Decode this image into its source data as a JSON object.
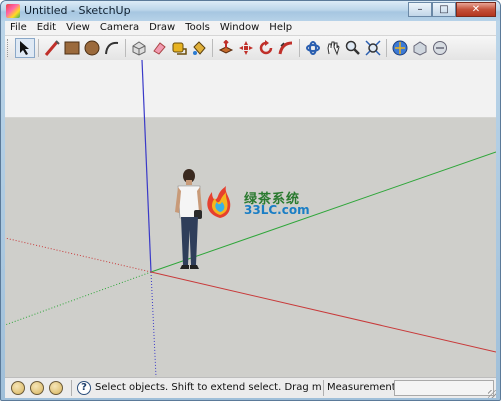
{
  "window": {
    "title": "Untitled - SketchUp",
    "controls": {
      "minimize": "–",
      "maximize": "□",
      "close": "✕"
    }
  },
  "menu": {
    "items": [
      "File",
      "Edit",
      "View",
      "Camera",
      "Draw",
      "Tools",
      "Window",
      "Help"
    ]
  },
  "toolbar": {
    "tools": [
      "select-icon",
      "line-icon",
      "rectangle-icon",
      "circle-icon",
      "arc-icon",
      "make-component-icon",
      "eraser-icon",
      "tape-measure-icon",
      "paint-bucket-icon",
      "push-pull-icon",
      "move-icon",
      "rotate-icon",
      "follow-me-icon",
      "orbit-icon",
      "pan-icon",
      "zoom-icon",
      "zoom-extents-icon",
      "get-models-icon",
      "share-model-icon",
      "share-component-icon"
    ],
    "active_tool": "select-icon"
  },
  "viewport": {
    "axis_colors": {
      "red": "#c83a3a",
      "green": "#2fa63a",
      "blue": "#3a3ac8"
    },
    "watermark": {
      "line1": "绿茶系统",
      "line2": "33LC.com"
    }
  },
  "statusbar": {
    "hint": "Select objects. Shift to extend select. Drag mo",
    "measurements_label": "Measurements",
    "measurements_value": ""
  }
}
